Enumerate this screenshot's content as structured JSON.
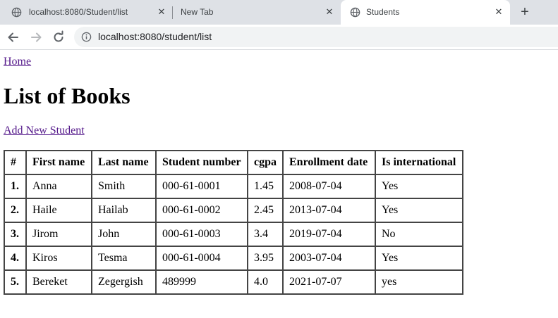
{
  "browser": {
    "tabs": [
      {
        "title": "localhost:8080/Student/list",
        "active": false
      },
      {
        "title": "New Tab",
        "active": false
      },
      {
        "title": "Students",
        "active": true
      }
    ],
    "close_glyph": "✕",
    "new_tab_glyph": "+",
    "url": "localhost:8080/student/list",
    "icons": [
      "globe-icon",
      "back-arrow-icon",
      "forward-arrow-icon",
      "reload-icon",
      "info-icon",
      "close-icon",
      "plus-icon"
    ]
  },
  "page": {
    "home_link": "Home",
    "heading": "List of Books",
    "add_link": "Add New Student"
  },
  "table": {
    "headers": [
      "#",
      "First name",
      "Last name",
      "Student number",
      "cgpa",
      "Enrollment date",
      "Is international"
    ],
    "rows": [
      [
        "1.",
        "Anna",
        "Smith",
        "000-61-0001",
        "1.45",
        "2008-07-04",
        "Yes"
      ],
      [
        "2.",
        "Haile",
        "Hailab",
        "000-61-0002",
        "2.45",
        "2013-07-04",
        "Yes"
      ],
      [
        "3.",
        "Jirom",
        "John",
        "000-61-0003",
        "3.4",
        "2019-07-04",
        "No"
      ],
      [
        "4.",
        "Kiros",
        "Tesma",
        "000-61-0004",
        "3.95",
        "2003-07-04",
        "Yes"
      ],
      [
        "5.",
        "Bereket",
        "Zegergish",
        "489999",
        "4.0",
        "2021-07-07",
        "yes"
      ]
    ]
  },
  "colors": {
    "tabstrip": "#dee1e6",
    "link": "#551a8b",
    "table_border": "#444444"
  }
}
